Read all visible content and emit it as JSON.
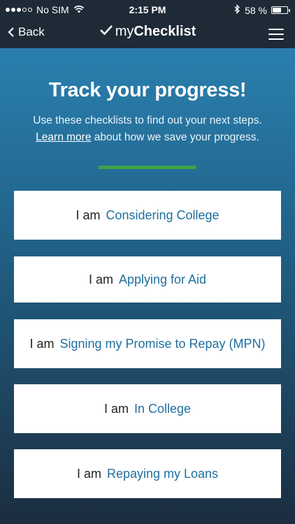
{
  "status_bar": {
    "carrier": "No SIM",
    "time": "2:15 PM",
    "battery": "58 %",
    "battery_level": 0.58,
    "signal_bars": 3,
    "signal_total": 5
  },
  "nav": {
    "back_label": "Back",
    "title_light": "my",
    "title_bold": "Checklist"
  },
  "main": {
    "heading": "Track your progress!",
    "description_line1": "Use these checklists to find out your next steps.",
    "learn_more_link": "Learn more",
    "description_line2_rest": " about how we save your progress.",
    "accent_color": "#3ca245"
  },
  "options": [
    {
      "lead": "I am",
      "label": "Considering College"
    },
    {
      "lead": "I am",
      "label": "Applying for Aid"
    },
    {
      "lead": "I am",
      "label": "Signing my Promise to Repay (MPN)"
    },
    {
      "lead": "I am",
      "label": "In College"
    },
    {
      "lead": "I am",
      "label": "Repaying my Loans"
    }
  ]
}
